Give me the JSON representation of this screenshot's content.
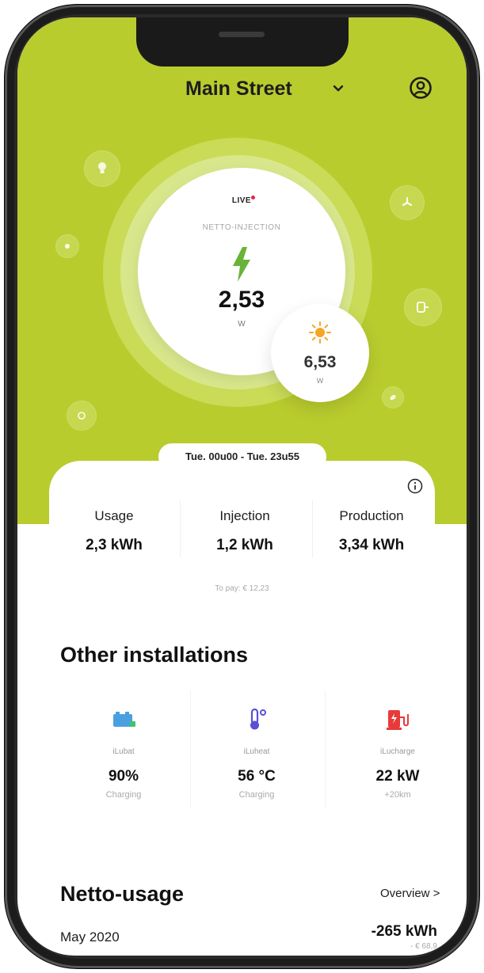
{
  "header": {
    "location": "Main Street"
  },
  "live": {
    "badge": "LIVE",
    "label": "NETTO-INJECTION",
    "value": "2,53",
    "unit": "W"
  },
  "solar": {
    "value": "6,53",
    "unit": "W"
  },
  "period": {
    "range": "Tue. 00u00 - Tue. 23u55"
  },
  "stats": [
    {
      "label": "Usage",
      "value": "2,3 kWh"
    },
    {
      "label": "Injection",
      "value": "1,2 kWh"
    },
    {
      "label": "Production",
      "value": "3,34 kWh"
    }
  ],
  "to_pay": "To pay: € 12,23",
  "installations": {
    "title": "Other installations",
    "items": [
      {
        "name": "iLubat",
        "value": "90%",
        "sub": "Charging",
        "icon": "battery-icon",
        "color": "#4a9fe0"
      },
      {
        "name": "iLuheat",
        "value": "56 °C",
        "sub": "Charging",
        "icon": "thermometer-icon",
        "color": "#5a4fd8"
      },
      {
        "name": "iLucharge",
        "value": "22 kW",
        "sub": "+20km",
        "icon": "ev-charger-icon",
        "color": "#e83a3a"
      }
    ]
  },
  "netto_usage": {
    "title": "Netto-usage",
    "overview_label": "Overview >",
    "month": "May 2020",
    "value": "-265 kWh",
    "cost": "- € 68,9"
  },
  "colors": {
    "hero": "#b9cc2e",
    "bolt": "#6ab33a",
    "live_dot": "#e8224a"
  }
}
